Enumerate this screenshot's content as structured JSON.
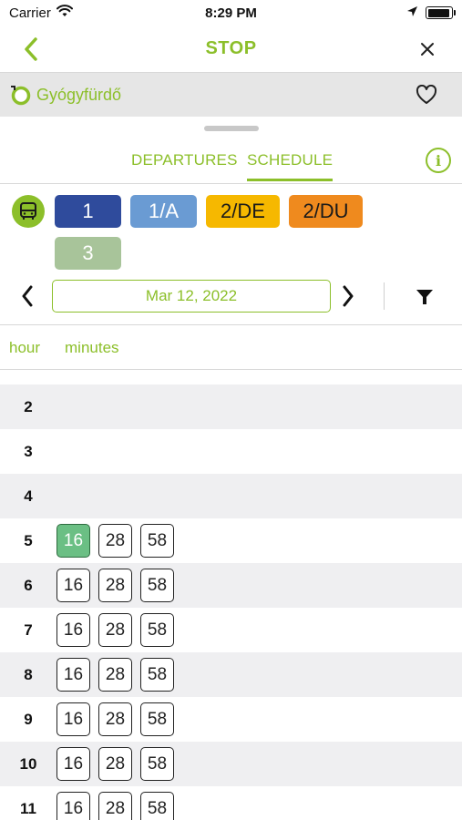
{
  "status_bar": {
    "carrier": "Carrier",
    "time": "8:29 PM",
    "battery_level": 0.95
  },
  "nav": {
    "title": "STOP"
  },
  "stop": {
    "name": "Gyógyfürdő"
  },
  "tabs": [
    {
      "label": "DEPARTURES",
      "active": false
    },
    {
      "label": "SCHEDULE",
      "active": true
    }
  ],
  "info_label": "i",
  "routes": [
    {
      "label": "1",
      "color": "#2f4b9c"
    },
    {
      "label": "1/A",
      "color": "#6a9bd3"
    },
    {
      "label": "2/DE",
      "color": "#f6b800"
    },
    {
      "label": "2/DU",
      "color": "#ef8a1e"
    },
    {
      "label": "3",
      "color": "#a8c49a"
    }
  ],
  "date": "Mar 12, 2022",
  "columns": {
    "hour": "hour",
    "minutes": "minutes"
  },
  "schedule": [
    {
      "hour": "2",
      "minutes": []
    },
    {
      "hour": "3",
      "minutes": []
    },
    {
      "hour": "4",
      "minutes": []
    },
    {
      "hour": "5",
      "minutes": [
        "16",
        "28",
        "58"
      ],
      "next_index": 0
    },
    {
      "hour": "6",
      "minutes": [
        "16",
        "28",
        "58"
      ]
    },
    {
      "hour": "7",
      "minutes": [
        "16",
        "28",
        "58"
      ]
    },
    {
      "hour": "8",
      "minutes": [
        "16",
        "28",
        "58"
      ]
    },
    {
      "hour": "9",
      "minutes": [
        "16",
        "28",
        "58"
      ]
    },
    {
      "hour": "10",
      "minutes": [
        "16",
        "28",
        "58"
      ]
    },
    {
      "hour": "11",
      "minutes": [
        "16",
        "28",
        "58"
      ]
    }
  ],
  "colors": {
    "accent": "#8cbf2a",
    "next_departure": "#6bbf84"
  },
  "icons": [
    "wifi-icon",
    "location-arrow-icon",
    "battery-icon",
    "back-chevron-icon",
    "close-icon",
    "stop-circle-icon",
    "heart-icon",
    "info-icon",
    "bus-icon",
    "chevron-left-icon",
    "chevron-right-icon",
    "filter-icon"
  ]
}
